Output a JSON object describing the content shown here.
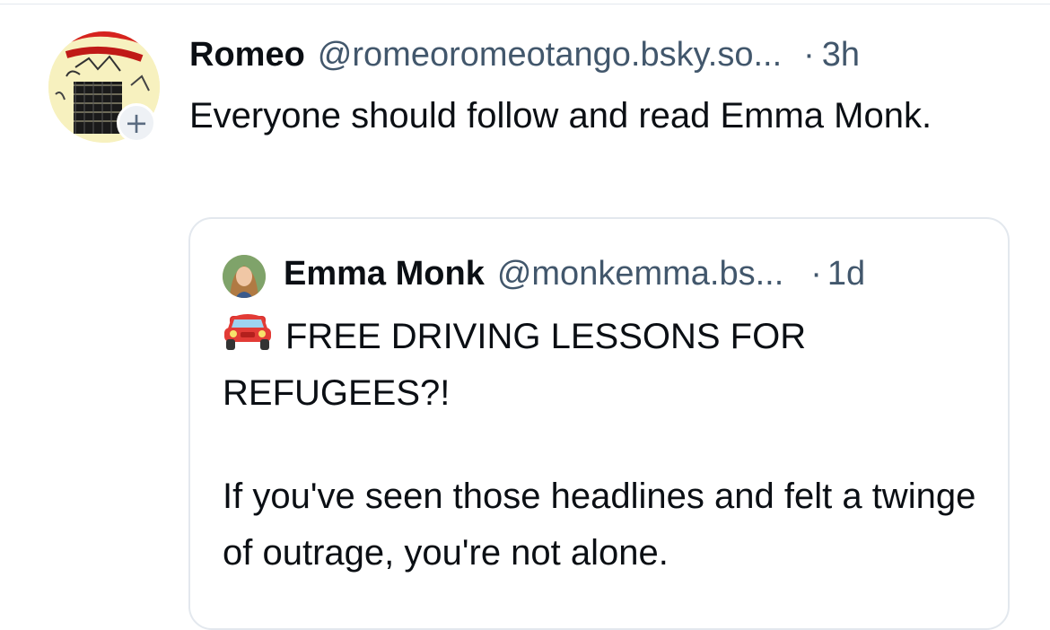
{
  "post": {
    "author_name": "Romeo",
    "author_handle": "@romeoromeotango.bsky.so...",
    "separator": "·",
    "time": "3h",
    "follow_symbol": "+",
    "text": "Everyone should follow and read Emma Monk."
  },
  "quote": {
    "author_name": "Emma Monk",
    "author_handle": "@monkemma.bs...",
    "separator": "·",
    "time": "1d",
    "icon": "car-icon",
    "line1": "FREE DRIVING LESSONS FOR REFUGEES?!",
    "line2": "If you've seen those headlines and felt a twinge of outrage, you're not alone."
  },
  "colors": {
    "text": "#0b0f14",
    "muted": "#42576c",
    "border": "#e3e8ee"
  }
}
